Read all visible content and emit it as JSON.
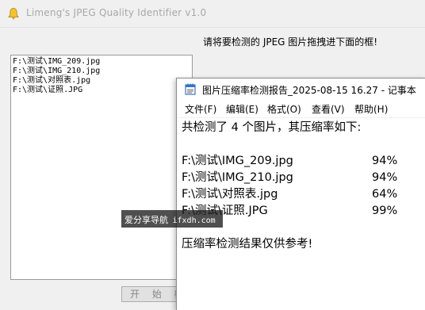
{
  "app": {
    "title": "Limeng's JPEG Quality Identifier v1.0",
    "instruction": "请将要检测的 JPEG 图片拖拽进下面的框!",
    "files": [
      "F:\\测试\\IMG_209.jpg",
      "F:\\测试\\IMG_210.jpg",
      "F:\\测试\\对照表.jpg",
      "F:\\测试\\证照.JPG"
    ],
    "start_button": "开 始 检 测"
  },
  "notepad": {
    "title": "图片压缩率检测报告_2025-08-15 16.27 - 记事本",
    "menu": [
      "文件(F)",
      "编辑(E)",
      "格式(O)",
      "查看(V)",
      "帮助(H)"
    ],
    "summary": "共检测了 4 个图片，其压缩率如下:",
    "results": [
      {
        "path": "F:\\测试\\IMG_209.jpg",
        "rate": "94%"
      },
      {
        "path": "F:\\测试\\IMG_210.jpg",
        "rate": "94%"
      },
      {
        "path": "F:\\测试\\对照表.jpg",
        "rate": "64%"
      },
      {
        "path": "F:\\测试\\证照.JPG",
        "rate": "99%"
      }
    ],
    "footer": "压缩率检测结果仅供参考!"
  },
  "watermark": {
    "text_cn": "爱分享导航",
    "text_domain": "ifxdh.com"
  },
  "colors": {
    "window_bg": "#f0f0f0",
    "title_text": "#a8a8a8",
    "notepad_bg": "#ffffff"
  },
  "icons": {
    "app_icon": "bell-icon",
    "notepad_icon": "notepad-icon"
  }
}
